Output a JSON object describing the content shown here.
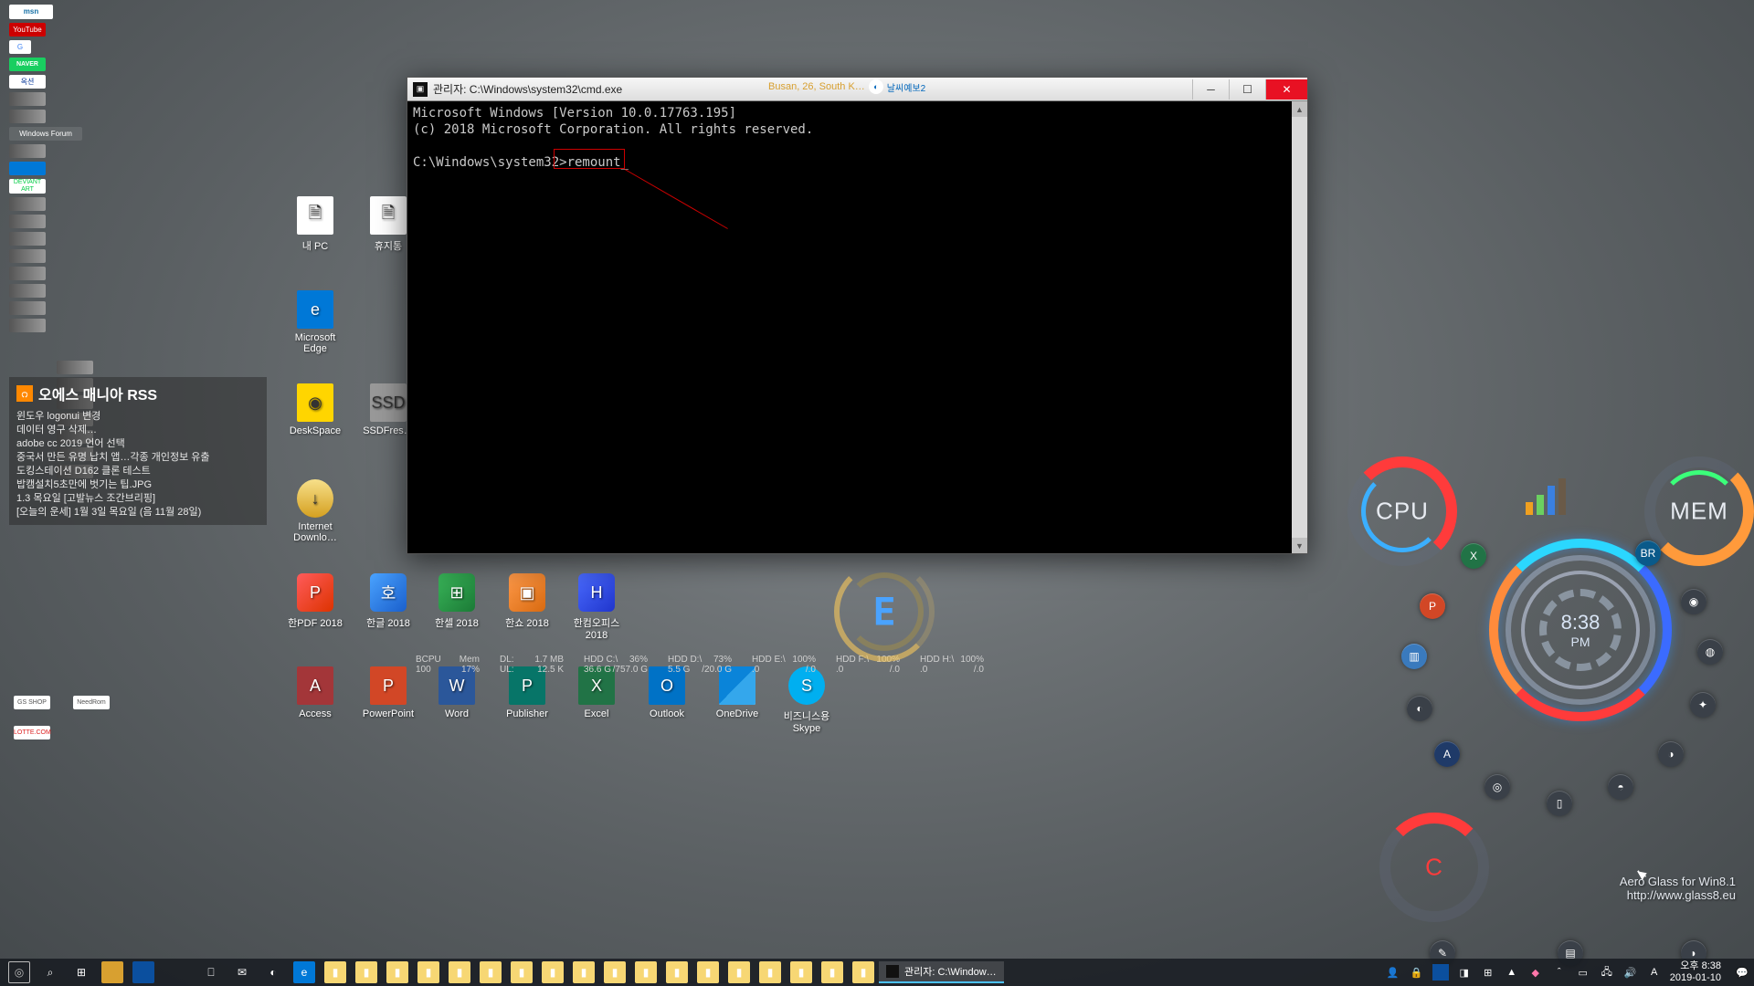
{
  "cmd": {
    "title": "관리자: C:\\Windows\\system32\\cmd.exe",
    "line1": "Microsoft Windows [Version 10.0.17763.195]",
    "line2": "(c) 2018 Microsoft Corporation. All rights reserved.",
    "prompt": "C:\\Windows\\system32>",
    "command": "remount",
    "weather": "Busan, 26, South K…",
    "weather_badge": "날씨예보2"
  },
  "desktop": {
    "mypc": "내 PC",
    "trash": "휴지통",
    "edge": "Microsoft Edge",
    "deskspace": "DeskSpace",
    "ssdfresh": "SSDFres…",
    "idm": "Internet Downlo…",
    "hanpdf": "한PDF 2018",
    "hangul": "한글 2018",
    "hansel": "한셀 2018",
    "hansho": "한쇼 2018",
    "hanoffice": "한컴오피스 2018",
    "access": "Access",
    "ppt": "PowerPoint",
    "word": "Word",
    "publisher": "Publisher",
    "excel": "Excel",
    "outlook": "Outlook",
    "onedrive": "OneDrive",
    "skype": "비즈니스용 Skype"
  },
  "rss": {
    "title": "오에스 매니아 RSS",
    "items": [
      "윈도우 logonui 변경",
      "데이터 영구 삭제…",
      "adobe cc 2019 언어 선택",
      "중국서 만든 유명 납치 앱…각종 개인정보 유출",
      "도킹스테이션 D162 클론 테스트",
      "밥캠설치5초만에 벗기는 팁.JPG",
      "1.3 목요일 [고발뉴스 조간브리핑]",
      "[오늘의 운세] 1월 3일 목요일 (음 11월 28일)"
    ]
  },
  "hdd_left": {
    "bcpu_label": "BCPU",
    "bcpu_val": "100",
    "mem_label": "Mem",
    "mem_val": "17%",
    "dl_label": "DL:",
    "dl_val": "1.7 MB",
    "ul_label": "UL:",
    "ul_val": "12.5 K"
  },
  "disks": [
    {
      "name": "HDD C:\\",
      "pct": "36%",
      "used": "36.6 G",
      "total": "/757.0 G"
    },
    {
      "name": "HDD D:\\",
      "pct": "73%",
      "used": "5.5 G",
      "total": "/20.0 G"
    },
    {
      "name": "HDD E:\\",
      "pct": "100%",
      "used": ".0",
      "total": "/.0"
    },
    {
      "name": "HDD F:\\",
      "pct": "100%",
      "used": ".0",
      "total": "/.0"
    },
    {
      "name": "HDD H:\\",
      "pct": "100%",
      "used": ".0",
      "total": "/.0"
    }
  ],
  "gauges": {
    "cpu": "CPU",
    "mem": "MEM",
    "c": "C"
  },
  "clock": {
    "time": "8:38",
    "period": "PM"
  },
  "watermark": {
    "l1": "Aero Glass for Win8.1",
    "l2": "http://www.glass8.eu"
  },
  "taskbar": {
    "active_app": "관리자: C:\\Window…",
    "ime": "A",
    "time": "오후 8:38",
    "date": "2019-01-10"
  },
  "bookmarks": {
    "msn": "msn",
    "yt": "YouTube",
    "gg": "G",
    "nv": "NAVER",
    "auction": "옥션",
    "wf": "Windows Forum",
    "dv": "DEVIANT ART"
  },
  "center_letter": "E"
}
